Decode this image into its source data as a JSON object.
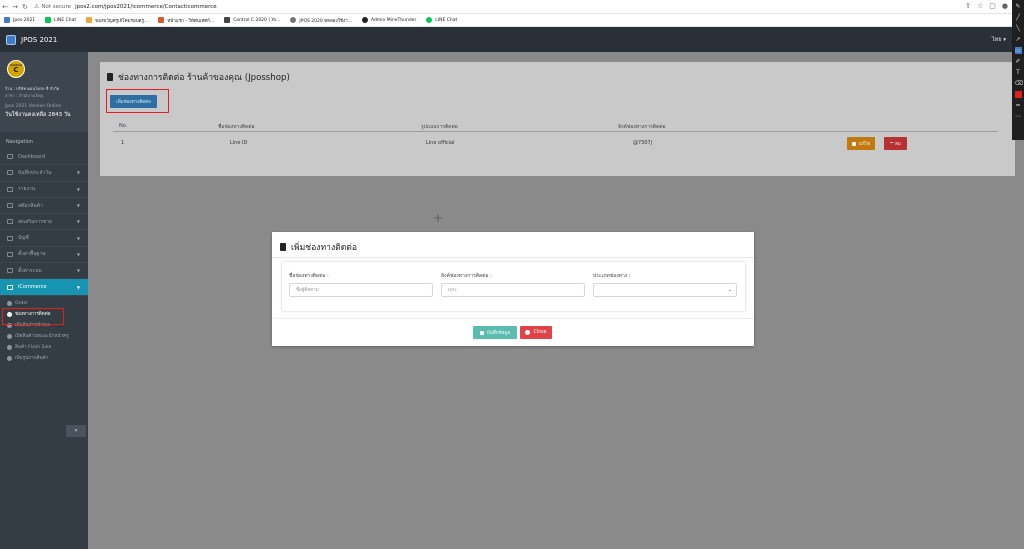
{
  "browser": {
    "not_secure": "Not secure",
    "url": "jpos2.com/jpos2021/icommerce/Contacticommerce",
    "bookmarks": [
      "Jpos 2021",
      "LINE Chat",
      "ของขวัญครูเจ้โคมรอบครู...",
      "หน้าแรก - วิทัศนเทศก์...",
      "Control C 2020 | Yo...",
      "JPOS 2020 ทดลองใช้งา...",
      "Admin MineThunder",
      "LINE Chat"
    ]
  },
  "appbar": {
    "title": "JPOS 2021",
    "language": "ไทย ▾"
  },
  "profile": {
    "avatar_top": "Control",
    "avatar_letter": "C",
    "company": "ร้าน : บริษัท คอนโทรล ซี จำกัด",
    "branch": "สาขา : สำนักงานใหญ่",
    "version": "Jpos 2021 Version Online",
    "days_left": "วันใช้งานคงเหลือ 2843 วัน"
  },
  "sidebar": {
    "heading": "Navigation",
    "items": [
      {
        "label": "Dashboard"
      },
      {
        "label": "บันทึกประจำวัน"
      },
      {
        "label": "รายงาน"
      },
      {
        "label": "สต๊อกสินค้า"
      },
      {
        "label": "ส่งเสริมการขาย"
      },
      {
        "label": "บัญชี"
      },
      {
        "label": "ตั้งค่าพื้นฐาน"
      },
      {
        "label": "ตั้งค่าระบบ"
      },
      {
        "label": "iCommerce"
      }
    ],
    "submenu": [
      {
        "label": "Order"
      },
      {
        "label": "ช่องทางการติดต่อ"
      },
      {
        "label": "เพิ่มสินค้าหน้าเพจ"
      },
      {
        "label": "เปิดสินค้าบทแนะนำหน้าครู"
      },
      {
        "label": "สินค้า Flash Sale"
      },
      {
        "label": "เพิ่มรูปภาพสินค้า"
      }
    ],
    "collapse": "«"
  },
  "content": {
    "title": "ช่องทางการติดต่อ ร้านค้าของคุณ (Jposshop)",
    "add_button": "เพิ่มช่องทางติดต่อ",
    "table": {
      "headers": [
        "No.",
        "ชื่อช่องทางติดต่อ",
        "รูปแบบการติดต่อ",
        "ลิงค์ช่องทางการติดต่อ"
      ],
      "rows": [
        {
          "no": "1",
          "name": "Line ID",
          "type": "Line official",
          "link": "@7307j"
        }
      ]
    },
    "edit_label": "แก้ไข",
    "delete_label": "ลบ"
  },
  "modal": {
    "title": "เพิ่มช่องทางติดต่อ",
    "field_name_label": "ชื่อช่องทางติดต่อ :",
    "field_name_placeholder": "ชื่อผู้ติดตาม",
    "field_link_label": "ลิงค์ช่องทางการติดต่อ :",
    "field_link_placeholder": "URL",
    "field_type_label": "ประเภทช่องทาง :",
    "field_type_value": "",
    "save_label": "บันทึกข้อมูล",
    "close_label": "Close"
  },
  "colors": {
    "sidebar_bg": "#343c44",
    "appbar_bg": "#2a3037",
    "active_menu": "#1894b3",
    "primary_button": "#2d6fa3",
    "edit_button": "#c27a10",
    "delete_button": "#b83030",
    "save_button": "#5bbcb1",
    "close_button": "#e04347",
    "annotation_red": "#e02020"
  }
}
